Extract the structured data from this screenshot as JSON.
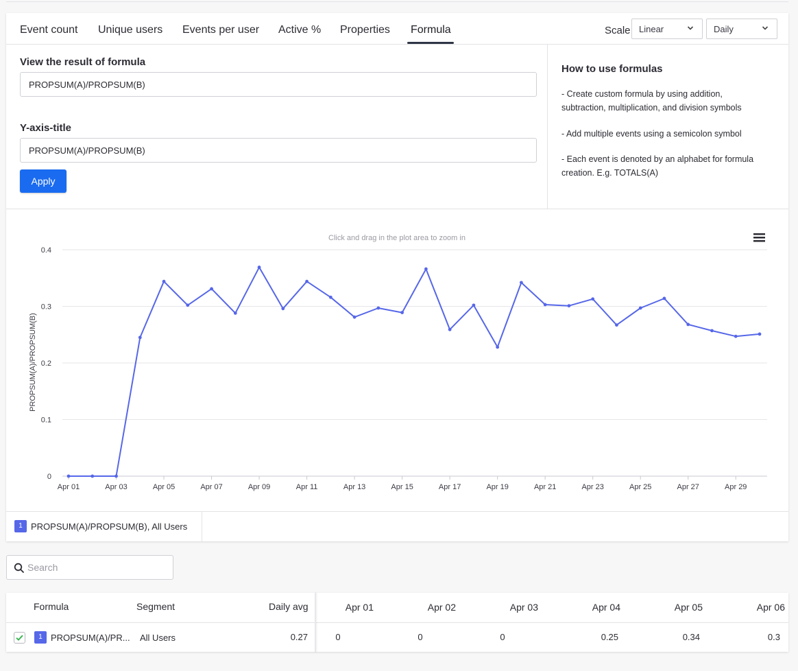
{
  "tabs": [
    {
      "label": "Event count"
    },
    {
      "label": "Unique users"
    },
    {
      "label": "Events per user"
    },
    {
      "label": "Active %"
    },
    {
      "label": "Properties"
    },
    {
      "label": "Formula"
    }
  ],
  "active_tab": "Formula",
  "scale": {
    "label": "Scale",
    "value": "Linear",
    "interval": "Daily"
  },
  "formula": {
    "result_label": "View the result of formula",
    "result_value": "PROPSUM(A)/PROPSUM(B)",
    "yaxis_label": "Y-axis-title",
    "yaxis_value": "PROPSUM(A)/PROPSUM(B)",
    "apply_label": "Apply"
  },
  "help": {
    "title": "How to use formulas",
    "items": [
      "- Create custom formula by using addition, subtraction, multiplication, and division symbols",
      "- Add multiple events using a semicolon symbol",
      "- Each event is denoted by an alphabet for formula creation. E.g. TOTALS(A)"
    ]
  },
  "chart_data": {
    "type": "line",
    "hint": "Click and drag in the plot area to zoom in",
    "ylabel": "PROPSUM(A)/PROPSUM(B)",
    "ylim": [
      0,
      0.4
    ],
    "yticks": [
      "0",
      "0.1",
      "0.2",
      "0.3",
      "0.4"
    ],
    "xticks": [
      "Apr 01",
      "Apr 03",
      "Apr 05",
      "Apr 07",
      "Apr 09",
      "Apr 11",
      "Apr 13",
      "Apr 15",
      "Apr 17",
      "Apr 19",
      "Apr 21",
      "Apr 23",
      "Apr 25",
      "Apr 27",
      "Apr 29"
    ],
    "grid": true,
    "color": "#5667e8",
    "series": [
      {
        "name": "PROPSUM(A)/PROPSUM(B), All Users",
        "x": [
          "Apr 01",
          "Apr 02",
          "Apr 03",
          "Apr 04",
          "Apr 05",
          "Apr 06",
          "Apr 07",
          "Apr 08",
          "Apr 09",
          "Apr 10",
          "Apr 11",
          "Apr 12",
          "Apr 13",
          "Apr 14",
          "Apr 15",
          "Apr 16",
          "Apr 17",
          "Apr 18",
          "Apr 19",
          "Apr 20",
          "Apr 21",
          "Apr 22",
          "Apr 23",
          "Apr 24",
          "Apr 25",
          "Apr 26",
          "Apr 27",
          "Apr 28",
          "Apr 29",
          "Apr 30"
        ],
        "values": [
          0,
          0,
          0,
          0.245,
          0.344,
          0.302,
          0.331,
          0.288,
          0.369,
          0.296,
          0.344,
          0.316,
          0.281,
          0.297,
          0.289,
          0.366,
          0.259,
          0.302,
          0.228,
          0.342,
          0.303,
          0.301,
          0.313,
          0.267,
          0.297,
          0.314,
          0.268,
          0.257,
          0.247,
          0.251
        ]
      }
    ]
  },
  "legend": {
    "badge": "1",
    "label": "PROPSUM(A)/PROPSUM(B), All Users"
  },
  "search": {
    "placeholder": "Search"
  },
  "table": {
    "headers": {
      "formula": "Formula",
      "segment": "Segment",
      "daily_avg": "Daily avg"
    },
    "date_headers": [
      "Apr 01",
      "Apr 02",
      "Apr 03",
      "Apr 04",
      "Apr 05",
      "Apr 06"
    ],
    "row": {
      "badge": "1",
      "formula": "PROPSUM(A)/PR...",
      "segment": "All Users",
      "daily_avg": "0.27",
      "values": [
        "0",
        "0",
        "0",
        "0.25",
        "0.34",
        "0.3"
      ]
    }
  }
}
